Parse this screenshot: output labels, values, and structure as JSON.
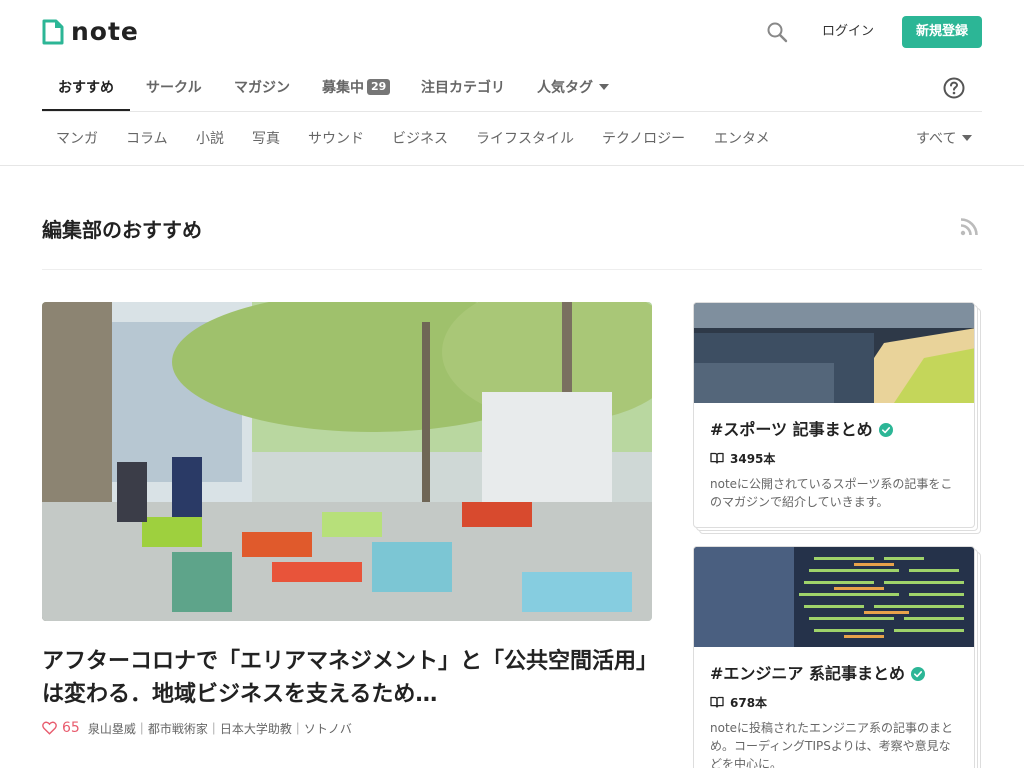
{
  "header": {
    "logo_text": "note",
    "login_label": "ログイン",
    "signup_label": "新規登録",
    "accent_color": "#2cb696"
  },
  "nav": {
    "items": [
      {
        "label": "おすすめ",
        "active": true
      },
      {
        "label": "サークル"
      },
      {
        "label": "マガジン"
      },
      {
        "label": "募集中",
        "badge": "29"
      },
      {
        "label": "注目カテゴリ"
      },
      {
        "label": "人気タグ",
        "dropdown": true
      }
    ],
    "help_icon": "question-circle-icon"
  },
  "categories": {
    "items": [
      "マンガ",
      "コラム",
      "小説",
      "写真",
      "サウンド",
      "ビジネス",
      "ライフスタイル",
      "テクノロジー",
      "エンタメ"
    ],
    "all_label": "すべて"
  },
  "section": {
    "title": "編集部のおすすめ",
    "rss_icon": "rss-icon"
  },
  "featured": {
    "title": "アフターコロナで「エリアマネジメント」と「公共空間活用」は変わる．地域ビジネスを支えるため…",
    "likes": "65",
    "author": "泉山塁威｜都市戦術家｜日本大学助教｜ソトノバ"
  },
  "magazines": [
    {
      "title": "#スポーツ 記事まとめ",
      "count": "3495本",
      "description": "noteに公開されているスポーツ系の記事をこのマガジンで紹介していきます。"
    },
    {
      "title": "#エンジニア 系記事まとめ",
      "count": "678本",
      "description": "noteに投稿されたエンジニア系の記事のまとめ。コーディングTIPSよりは、考察や意見などを中心に。"
    }
  ]
}
